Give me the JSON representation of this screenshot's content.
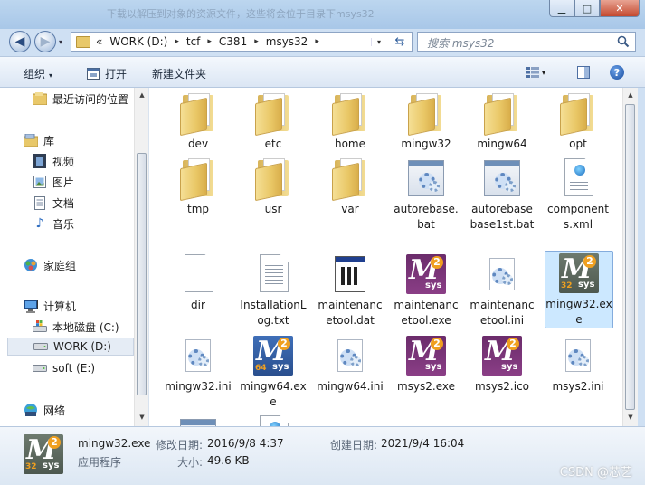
{
  "window": {
    "title": "下载以解压到对象的资源文件，这些将会位于目录下msys32",
    "controls": {
      "minimize": "▁",
      "maximize": "□",
      "close": "✕"
    }
  },
  "navigation": {
    "back_icon": "arrow-left-icon",
    "forward_icon": "arrow-right-icon",
    "breadcrumb_prefix": "«",
    "breadcrumb": [
      "WORK (D:)",
      "tcf",
      "C381",
      "msys32"
    ],
    "separator": "▸",
    "dropdown": "▾",
    "refresh": "⇆"
  },
  "search": {
    "placeholder": "搜索 msys32"
  },
  "toolbar": {
    "organize": "组织",
    "open": "打开",
    "new_folder": "新建文件夹",
    "dropdown_arrow": "▾",
    "help": "?"
  },
  "sidebar": {
    "recent": "最近访问的位置",
    "libraries": "库",
    "library_items": [
      "视频",
      "图片",
      "文档",
      "音乐"
    ],
    "homegroup": "家庭组",
    "computer": "计算机",
    "drives": [
      "本地磁盘 (C:)",
      "WORK (D:)",
      "soft (E:)"
    ],
    "network": "网络"
  },
  "files": [
    {
      "name": "dev",
      "type": "folder"
    },
    {
      "name": "etc",
      "type": "folder"
    },
    {
      "name": "home",
      "type": "folder"
    },
    {
      "name": "mingw32",
      "type": "folder"
    },
    {
      "name": "mingw64",
      "type": "folder"
    },
    {
      "name": "opt",
      "type": "folder"
    },
    {
      "name": "tmp",
      "type": "folder"
    },
    {
      "name": "usr",
      "type": "folder"
    },
    {
      "name": "var",
      "type": "folder"
    },
    {
      "name": "autorebase.bat",
      "type": "bat"
    },
    {
      "name": "autorebasebase1st.bat",
      "type": "bat"
    },
    {
      "name": "components.xml",
      "type": "xml"
    },
    {
      "name": "dir",
      "type": "blank"
    },
    {
      "name": "InstallationLog.txt",
      "type": "txt"
    },
    {
      "name": "maintenancetool.dat",
      "type": "dat"
    },
    {
      "name": "maintenancetool.exe",
      "type": "msys"
    },
    {
      "name": "maintenancetool.ini",
      "type": "ini"
    },
    {
      "name": "mingw32.exe",
      "type": "msys32",
      "selected": true
    },
    {
      "name": "mingw32.ini",
      "type": "ini"
    },
    {
      "name": "mingw64.exe",
      "type": "msys64"
    },
    {
      "name": "mingw64.ini",
      "type": "ini"
    },
    {
      "name": "msys2.exe",
      "type": "msys"
    },
    {
      "name": "msys2.ico",
      "type": "msys"
    },
    {
      "name": "msys2.ini",
      "type": "ini"
    }
  ],
  "details": {
    "filename": "mingw32.exe",
    "type": "应用程序",
    "modified_label": "修改日期:",
    "modified_value": "2016/9/8 4:37",
    "created_label": "创建日期:",
    "created_value": "2021/9/4 16:04",
    "size_label": "大小:",
    "size_value": "49.6 KB"
  },
  "watermark": "CSDN @芯艺"
}
